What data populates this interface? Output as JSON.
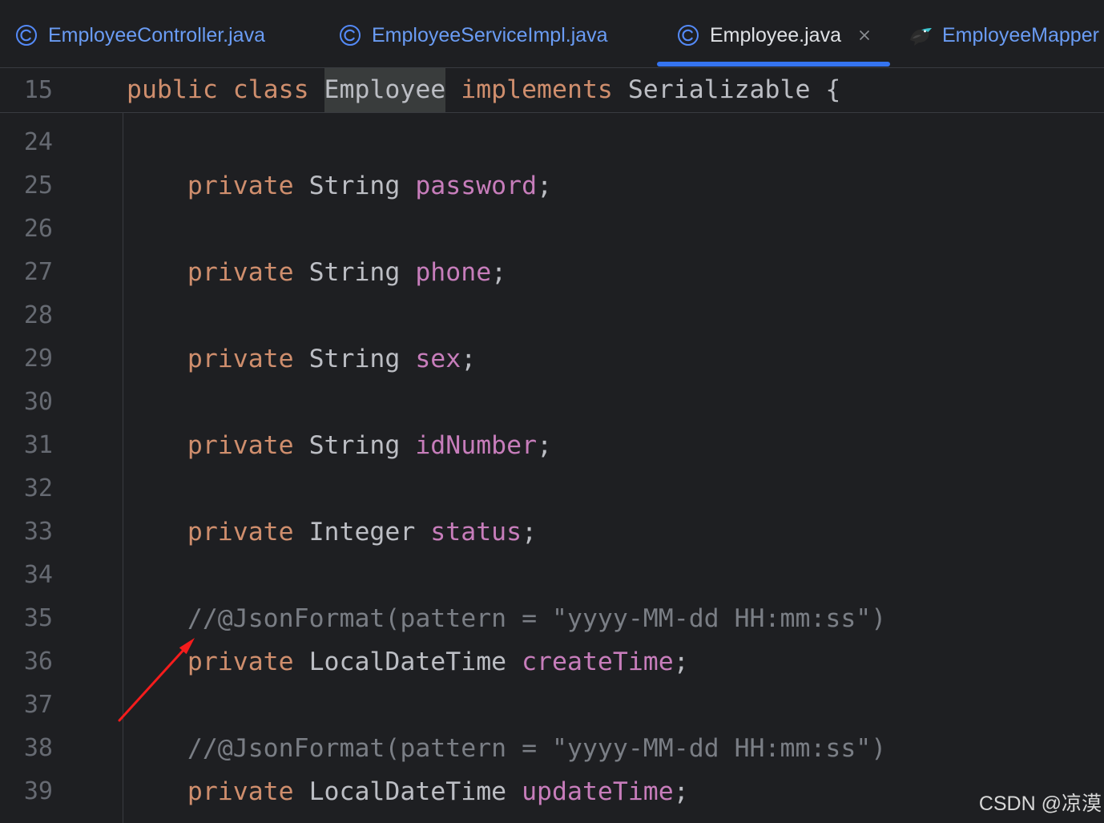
{
  "colors": {
    "accent": "#3574f0",
    "tab_text": "#6a9cf4",
    "tab_active_text": "#dfe1e5",
    "line_number": "#666a72",
    "class_icon": "#548af7"
  },
  "tabs": [
    {
      "label": "EmployeeController.java",
      "icon": "class-icon",
      "active": false
    },
    {
      "label": "EmployeeServiceImpl.java",
      "icon": "class-icon",
      "active": false
    },
    {
      "label": "Employee.java",
      "icon": "class-icon",
      "active": true,
      "closable": true
    },
    {
      "label": "EmployeeMapper",
      "icon": "mybatis-bird-icon",
      "active": false
    }
  ],
  "editor": {
    "sticky": {
      "number": "15",
      "tokens": [
        {
          "text": "public class ",
          "color": "#cf8e6d"
        },
        {
          "text": "Employee",
          "color": "#bcbec4",
          "background": "#393c3c"
        },
        {
          "text": " implements ",
          "color": "#cf8e6d"
        },
        {
          "text": "Serializable {",
          "color": "#bcbec4"
        }
      ]
    },
    "lines": [
      {
        "number": "24",
        "tokens": []
      },
      {
        "number": "25",
        "tokens": [
          {
            "text": "    private ",
            "color": "#cf8e6d"
          },
          {
            "text": "String ",
            "color": "#bcbec4"
          },
          {
            "text": "password",
            "color": "#c77dbb"
          },
          {
            "text": ";",
            "color": "#bcbec4"
          }
        ]
      },
      {
        "number": "26",
        "tokens": []
      },
      {
        "number": "27",
        "tokens": [
          {
            "text": "    private ",
            "color": "#cf8e6d"
          },
          {
            "text": "String ",
            "color": "#bcbec4"
          },
          {
            "text": "phone",
            "color": "#c77dbb"
          },
          {
            "text": ";",
            "color": "#bcbec4"
          }
        ]
      },
      {
        "number": "28",
        "tokens": []
      },
      {
        "number": "29",
        "tokens": [
          {
            "text": "    private ",
            "color": "#cf8e6d"
          },
          {
            "text": "String ",
            "color": "#bcbec4"
          },
          {
            "text": "sex",
            "color": "#c77dbb"
          },
          {
            "text": ";",
            "color": "#bcbec4"
          }
        ]
      },
      {
        "number": "30",
        "tokens": []
      },
      {
        "number": "31",
        "tokens": [
          {
            "text": "    private ",
            "color": "#cf8e6d"
          },
          {
            "text": "String ",
            "color": "#bcbec4"
          },
          {
            "text": "idNumber",
            "color": "#c77dbb"
          },
          {
            "text": ";",
            "color": "#bcbec4"
          }
        ]
      },
      {
        "number": "32",
        "tokens": []
      },
      {
        "number": "33",
        "tokens": [
          {
            "text": "    private ",
            "color": "#cf8e6d"
          },
          {
            "text": "Integer ",
            "color": "#bcbec4"
          },
          {
            "text": "status",
            "color": "#c77dbb"
          },
          {
            "text": ";",
            "color": "#bcbec4"
          }
        ]
      },
      {
        "number": "34",
        "tokens": []
      },
      {
        "number": "35",
        "tokens": [
          {
            "text": "    //@JsonFormat(pattern = \"yyyy-MM-dd HH:mm:ss\")",
            "color": "#7a7e85"
          }
        ]
      },
      {
        "number": "36",
        "tokens": [
          {
            "text": "    private ",
            "color": "#cf8e6d"
          },
          {
            "text": "LocalDateTime ",
            "color": "#bcbec4"
          },
          {
            "text": "createTime",
            "color": "#c77dbb"
          },
          {
            "text": ";",
            "color": "#bcbec4"
          }
        ]
      },
      {
        "number": "37",
        "tokens": []
      },
      {
        "number": "38",
        "tokens": [
          {
            "text": "    //@JsonFormat(pattern = \"yyyy-MM-dd HH:mm:ss\")",
            "color": "#7a7e85"
          }
        ]
      },
      {
        "number": "39",
        "tokens": [
          {
            "text": "    private ",
            "color": "#cf8e6d"
          },
          {
            "text": "LocalDateTime ",
            "color": "#bcbec4"
          },
          {
            "text": "updateTime",
            "color": "#c77dbb"
          },
          {
            "text": ";",
            "color": "#bcbec4"
          }
        ]
      }
    ]
  },
  "watermark": {
    "text": "CSDN @凉漠"
  }
}
